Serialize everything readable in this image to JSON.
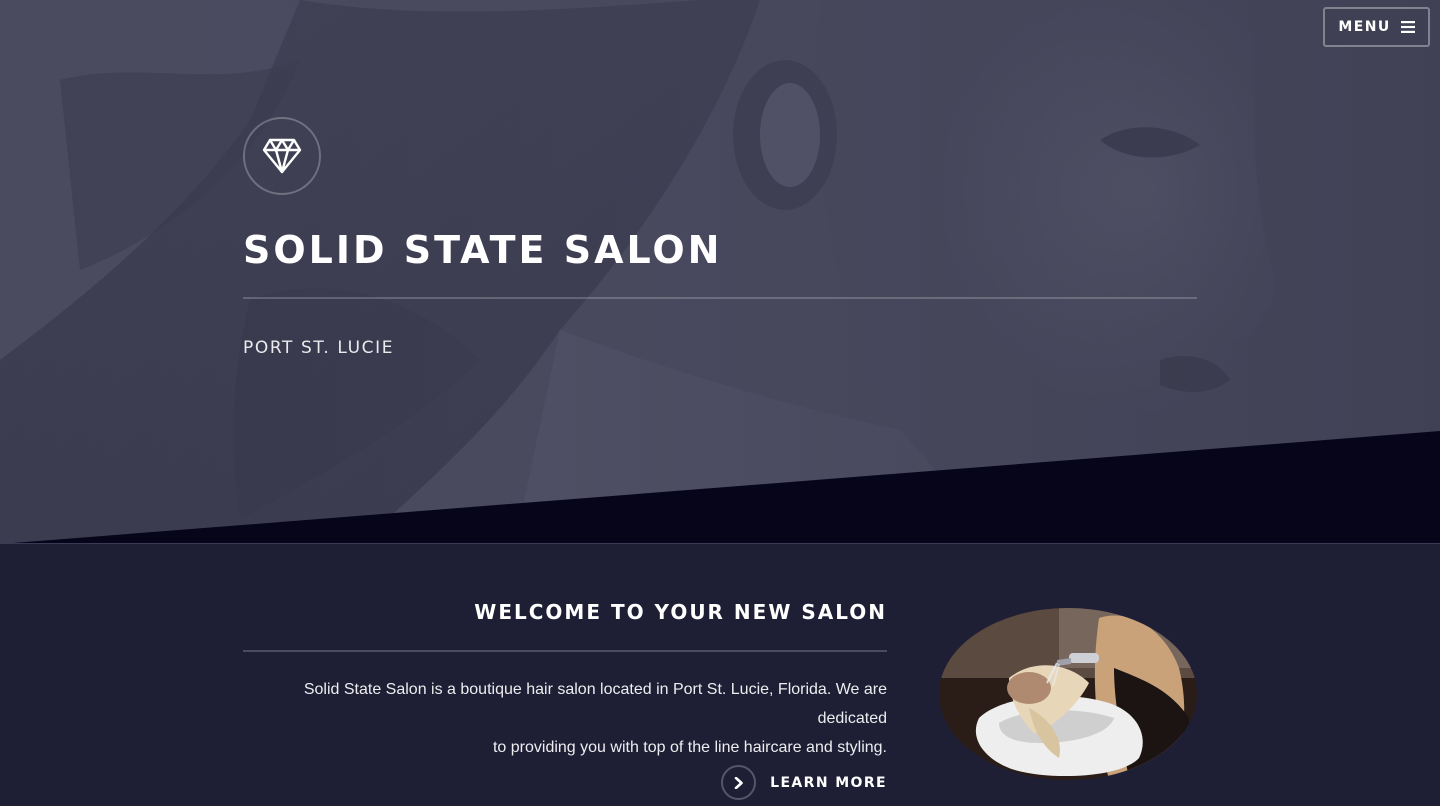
{
  "header": {
    "menu_label": "MENU",
    "menu_icon": "hamburger-icon"
  },
  "hero": {
    "badge_icon": "diamond-icon",
    "title": "SOLID STATE SALON",
    "subtitle": "PORT ST. LUCIE",
    "background_image": "portrait-photo"
  },
  "welcome": {
    "heading": "WELCOME TO YOUR NEW SALON",
    "paragraph_line1": "Solid State Salon is a boutique hair salon located in Port St. Lucie, Florida. We are dedicated",
    "paragraph_line2": "to providing you with top of the line haircare and styling.",
    "cta_label": "LEARN MORE",
    "cta_icon": "chevron-right-icon",
    "image": "hair-wash-photo"
  },
  "colors": {
    "hero_overlay": "#4a4a5f",
    "hero_diagonal": "#06051a",
    "section_background": "#1e1e35",
    "text": "#ffffff"
  }
}
